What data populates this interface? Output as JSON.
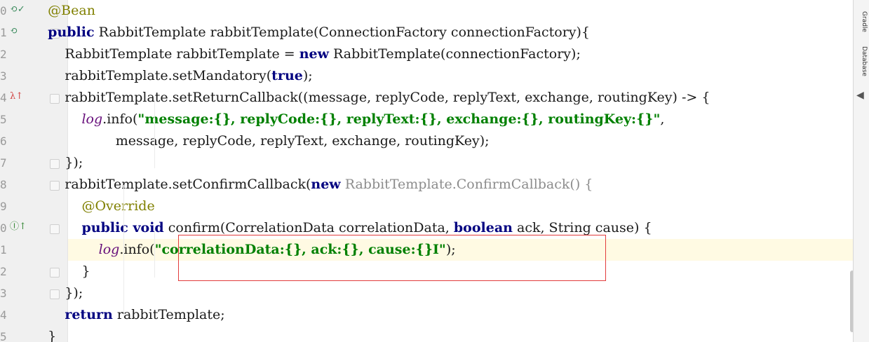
{
  "editor": {
    "lines": [
      {
        "num": "0",
        "tokens": [
          {
            "t": "    ",
            "c": ""
          },
          {
            "t": "@Bean",
            "c": "ann"
          }
        ]
      },
      {
        "num": "1",
        "tokens": [
          {
            "t": "    ",
            "c": ""
          },
          {
            "t": "public",
            "c": "kw"
          },
          {
            "t": " RabbitTemplate rabbitTemplate(ConnectionFactory connectionFactory){",
            "c": ""
          }
        ]
      },
      {
        "num": "2",
        "tokens": [
          {
            "t": "        RabbitTemplate rabbitTemplate = ",
            "c": ""
          },
          {
            "t": "new",
            "c": "kw"
          },
          {
            "t": " RabbitTemplate(connectionFactory);",
            "c": ""
          }
        ]
      },
      {
        "num": "3",
        "tokens": [
          {
            "t": "        rabbitTemplate.setMandatory(",
            "c": ""
          },
          {
            "t": "true",
            "c": "kw"
          },
          {
            "t": ");",
            "c": ""
          }
        ]
      },
      {
        "num": "4",
        "tokens": [
          {
            "t": "        rabbitTemplate.setReturnCallback((message, replyCode, replyText, exchange, routingKey) -> {",
            "c": ""
          }
        ]
      },
      {
        "num": "5",
        "tokens": [
          {
            "t": "            ",
            "c": ""
          },
          {
            "t": "log",
            "c": "fld"
          },
          {
            "t": ".info(",
            "c": ""
          },
          {
            "t": "\"message:{}, replyCode:{}, replyText:{}, exchange:{}, routingKey:{}\"",
            "c": "str"
          },
          {
            "t": ",",
            "c": ""
          }
        ]
      },
      {
        "num": "6",
        "tokens": [
          {
            "t": "                    message, replyCode, replyText, exchange, routingKey);",
            "c": ""
          }
        ]
      },
      {
        "num": "7",
        "tokens": [
          {
            "t": "        });",
            "c": ""
          }
        ]
      },
      {
        "num": "8",
        "tokens": [
          {
            "t": "        rabbitTemplate.setConfirmCallback(",
            "c": ""
          },
          {
            "t": "new",
            "c": "kw"
          },
          {
            "t": " RabbitTemplate.ConfirmCallback() {",
            "c": "gray"
          }
        ]
      },
      {
        "num": "9",
        "tokens": [
          {
            "t": "            ",
            "c": ""
          },
          {
            "t": "@Override",
            "c": "ann"
          }
        ]
      },
      {
        "num": "0",
        "tokens": [
          {
            "t": "            ",
            "c": ""
          },
          {
            "t": "public void",
            "c": "kw"
          },
          {
            "t": " confirm(CorrelationData correlationData, ",
            "c": ""
          },
          {
            "t": "boolean",
            "c": "kw"
          },
          {
            "t": " ack, String cause) {",
            "c": ""
          }
        ]
      },
      {
        "num": "1",
        "tokens": [
          {
            "t": "                ",
            "c": ""
          },
          {
            "t": "log",
            "c": "fld"
          },
          {
            "t": ".info(",
            "c": ""
          },
          {
            "t": "\"correlationData:{}, ack:{}, cause:{}I\"",
            "c": "str"
          },
          {
            "t": ");",
            "c": ""
          }
        ]
      },
      {
        "num": "2",
        "tokens": [
          {
            "t": "            }",
            "c": ""
          }
        ]
      },
      {
        "num": "3",
        "tokens": [
          {
            "t": "        });",
            "c": ""
          }
        ]
      },
      {
        "num": "4",
        "tokens": [
          {
            "t": "        ",
            "c": ""
          },
          {
            "t": "return",
            "c": "kw"
          },
          {
            "t": " rabbitTemplate;",
            "c": ""
          }
        ]
      },
      {
        "num": "5",
        "tokens": [
          {
            "t": "    }",
            "c": ""
          }
        ]
      }
    ]
  },
  "gutter_icons": [
    {
      "line": 0,
      "glyph": "⟲✓",
      "name": "bean-run-icon",
      "color": "#3a8a5c"
    },
    {
      "line": 1,
      "glyph": "⟲",
      "name": "bean-navigate-icon",
      "color": "#3a8a5c"
    },
    {
      "line": 4,
      "glyph": "λ↑",
      "name": "lambda-override-icon",
      "color": "#d04040"
    },
    {
      "line": 10,
      "glyph": "Ⓘ↑",
      "name": "implements-method-icon",
      "color": "#3a8a3a"
    }
  ],
  "sidebar": {
    "tabs": [
      "Gradle",
      "Database"
    ]
  },
  "colors": {
    "keyword": "#000080",
    "string": "#008000",
    "annotation": "#808000",
    "highlight_box": "#e23c3c"
  }
}
